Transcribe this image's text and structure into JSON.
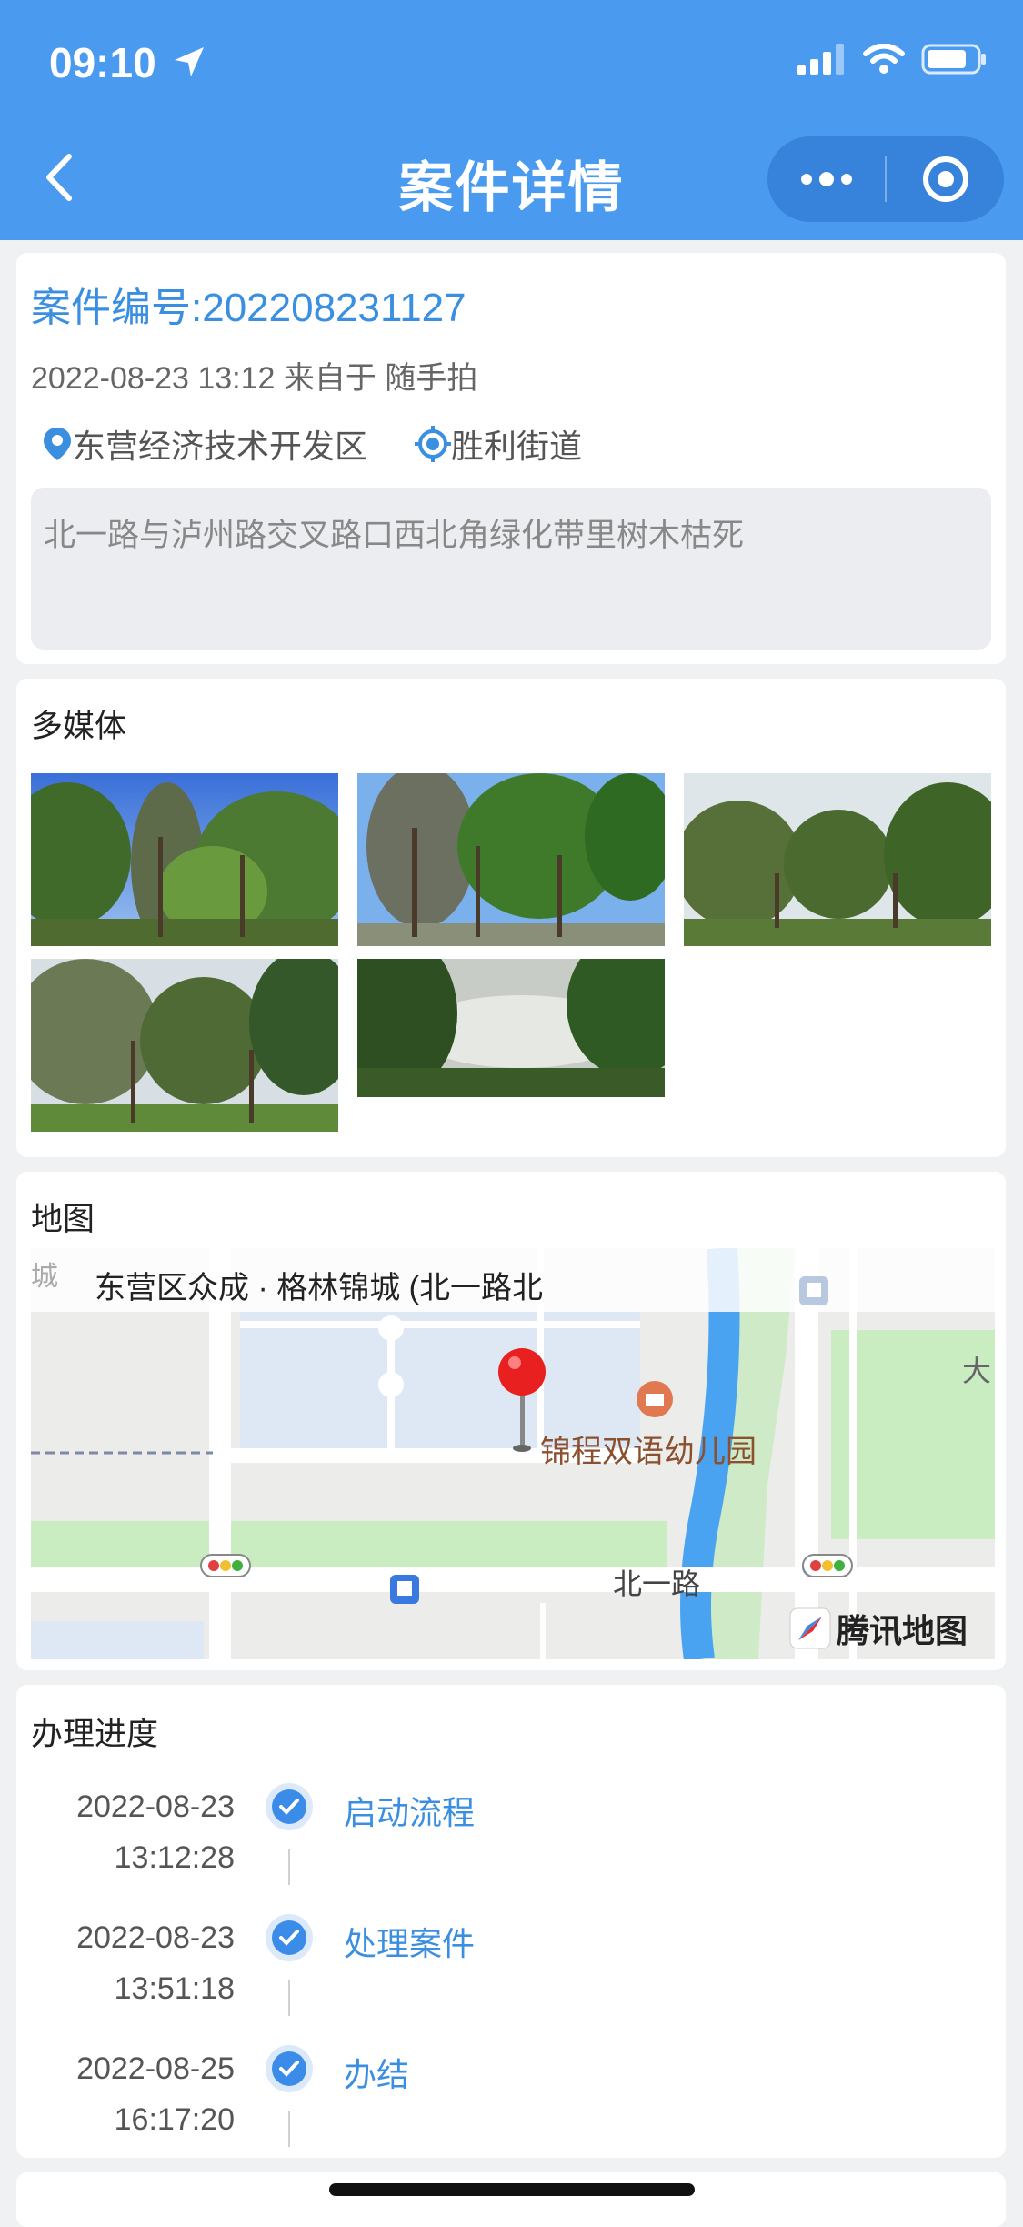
{
  "status": {
    "time": "09:10"
  },
  "nav": {
    "title": "案件详情"
  },
  "case": {
    "number": "案件编号:202208231127",
    "meta": "2022-08-23 13:12 来自于 随手拍",
    "district": "东营经济技术开发区",
    "street": "胜利街道",
    "description": "北一路与泸州路交叉路口西北角绿化带里树木枯死"
  },
  "media": {
    "title": "多媒体",
    "photo_count": 5
  },
  "map": {
    "title": "地图",
    "place": "东营区众成 · 格林锦城 (北一路北",
    "poi": "锦程双语幼儿园",
    "road": "北一路",
    "edge_left": "城",
    "edge_right": "大",
    "brand": "腾讯地图"
  },
  "progress": {
    "title": "办理进度",
    "steps": [
      {
        "date": "2022-08-23",
        "time": "13:12:28",
        "label": "启动流程"
      },
      {
        "date": "2022-08-23",
        "time": "13:51:18",
        "label": "处理案件"
      },
      {
        "date": "2022-08-25",
        "time": "16:17:20",
        "label": "办结"
      }
    ]
  },
  "colors": {
    "primary": "#4a9bf0",
    "link": "#3b8fe0",
    "pin": "#e82020"
  }
}
